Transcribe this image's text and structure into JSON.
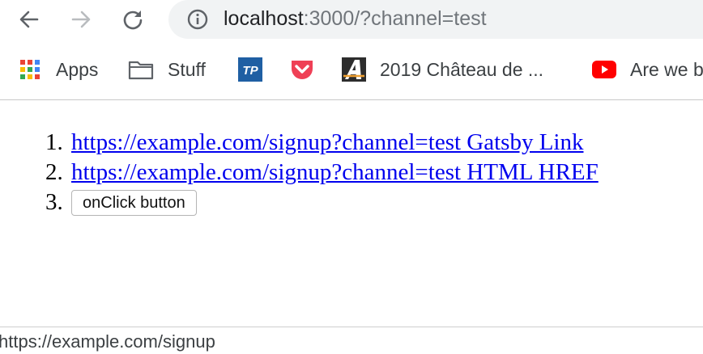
{
  "toolbar": {
    "back_icon": "arrow-left-icon",
    "forward_icon": "arrow-right-icon",
    "reload_icon": "reload-icon",
    "url_host": "localhost",
    "url_rest": ":3000/?channel=test"
  },
  "bookmarks": [
    {
      "label": "Apps",
      "icon": "apps-grid-icon"
    },
    {
      "label": "Stuff",
      "icon": "folder-icon"
    },
    {
      "label": "",
      "icon": "tp-icon"
    },
    {
      "label": "",
      "icon": "pocket-icon"
    },
    {
      "label": "2019 Château de ...",
      "icon": "a-logo-icon"
    },
    {
      "label": "Are we b",
      "icon": "youtube-icon"
    }
  ],
  "page": {
    "items": [
      {
        "number": "1.",
        "text": "https://example.com/signup?channel=test Gatsby Link"
      },
      {
        "number": "2.",
        "text": "https://example.com/signup?channel=test HTML HREF"
      },
      {
        "number": "3.",
        "text": "onClick button"
      }
    ]
  },
  "status": {
    "text": "https://example.com/signup"
  },
  "colors": {
    "link": "#0000ee",
    "omnibox": "#f1f3f4",
    "tp": "#1f5fa3",
    "pocket": "#ef4056",
    "youtube": "#ff0000"
  }
}
